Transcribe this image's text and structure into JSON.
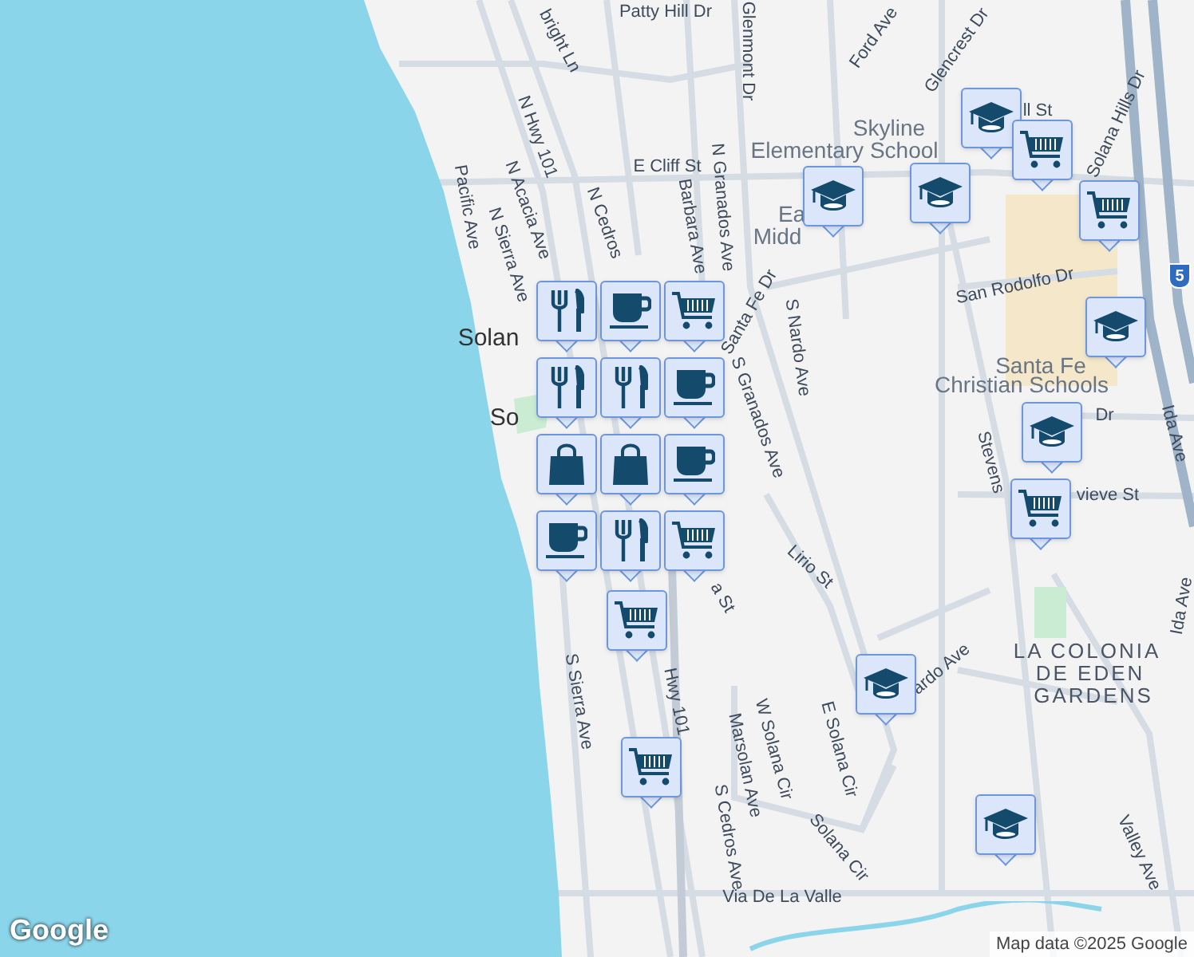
{
  "map": {
    "labels": [
      {
        "text": "Patty Hill Dr",
        "kind": "street"
      },
      {
        "text": "bright Ln",
        "kind": "street"
      },
      {
        "text": "Glenmont Dr",
        "kind": "street"
      },
      {
        "text": "Ford Ave",
        "kind": "street"
      },
      {
        "text": "Glencrest Dr",
        "kind": "street"
      },
      {
        "text": "Skyline",
        "kind": "poi"
      },
      {
        "text": "Elementary School",
        "kind": "poi"
      },
      {
        "text": "ll St",
        "kind": "street"
      },
      {
        "text": "Solana Hills Dr",
        "kind": "street"
      },
      {
        "text": "E Cliff St",
        "kind": "street"
      },
      {
        "text": "N Hwy 101",
        "kind": "street"
      },
      {
        "text": "Pacific Ave",
        "kind": "street"
      },
      {
        "text": "N Acacia Ave",
        "kind": "street"
      },
      {
        "text": "N Sierra Ave",
        "kind": "street"
      },
      {
        "text": "N Cedros",
        "kind": "street"
      },
      {
        "text": "Barbara Ave",
        "kind": "street"
      },
      {
        "text": "N Granados Ave",
        "kind": "street"
      },
      {
        "text": "Ea",
        "kind": "poi"
      },
      {
        "text": "Midd",
        "kind": "poi"
      },
      {
        "text": "Santa Fe Dr",
        "kind": "street"
      },
      {
        "text": "S Granados Ave",
        "kind": "street"
      },
      {
        "text": "S Nardo Ave",
        "kind": "street"
      },
      {
        "text": "San Rodolfo Dr",
        "kind": "street"
      },
      {
        "text": "Santa Fe",
        "kind": "poi"
      },
      {
        "text": "Christian Schools",
        "kind": "poi"
      },
      {
        "text": "Dr",
        "kind": "street"
      },
      {
        "text": "Stevens",
        "kind": "street"
      },
      {
        "text": "vieve St",
        "kind": "street"
      },
      {
        "text": "Ida Ave",
        "kind": "street"
      },
      {
        "text": "Lirio St",
        "kind": "street"
      },
      {
        "text": "LA COLONIA",
        "kind": "area"
      },
      {
        "text": "DE EDEN",
        "kind": "area"
      },
      {
        "text": "GARDENS",
        "kind": "area"
      },
      {
        "text": "ardo Ave",
        "kind": "street"
      },
      {
        "text": "S Sierra Ave",
        "kind": "street"
      },
      {
        "text": "Hwy 101",
        "kind": "street"
      },
      {
        "text": "a St",
        "kind": "street"
      },
      {
        "text": "Marsolan Ave",
        "kind": "street"
      },
      {
        "text": "W Solana Cir",
        "kind": "street"
      },
      {
        "text": "E Solana Cir",
        "kind": "street"
      },
      {
        "text": "Solana Cir",
        "kind": "street"
      },
      {
        "text": "S Cedros Ave",
        "kind": "street"
      },
      {
        "text": "Via De La Valle",
        "kind": "street"
      },
      {
        "text": "Valley Ave",
        "kind": "street"
      },
      {
        "text": "Ida Ave",
        "kind": "street"
      },
      {
        "text": "Solan",
        "kind": "city"
      },
      {
        "text": "So",
        "kind": "city"
      }
    ],
    "markers": [
      {
        "kind": "school"
      },
      {
        "kind": "cart"
      },
      {
        "kind": "school"
      },
      {
        "kind": "school"
      },
      {
        "kind": "cart"
      },
      {
        "kind": "school"
      },
      {
        "kind": "school"
      },
      {
        "kind": "cart"
      },
      {
        "kind": "school"
      },
      {
        "kind": "school"
      },
      {
        "kind": "restaurant"
      },
      {
        "kind": "cafe"
      },
      {
        "kind": "cart"
      },
      {
        "kind": "restaurant"
      },
      {
        "kind": "restaurant"
      },
      {
        "kind": "cafe"
      },
      {
        "kind": "shopping"
      },
      {
        "kind": "shopping"
      },
      {
        "kind": "cafe"
      },
      {
        "kind": "cafe"
      },
      {
        "kind": "restaurant"
      },
      {
        "kind": "cart"
      },
      {
        "kind": "cart"
      },
      {
        "kind": "cart"
      }
    ],
    "highway_shield": "5",
    "logo": "Google",
    "attribution": "Map data ©2025 Google"
  }
}
